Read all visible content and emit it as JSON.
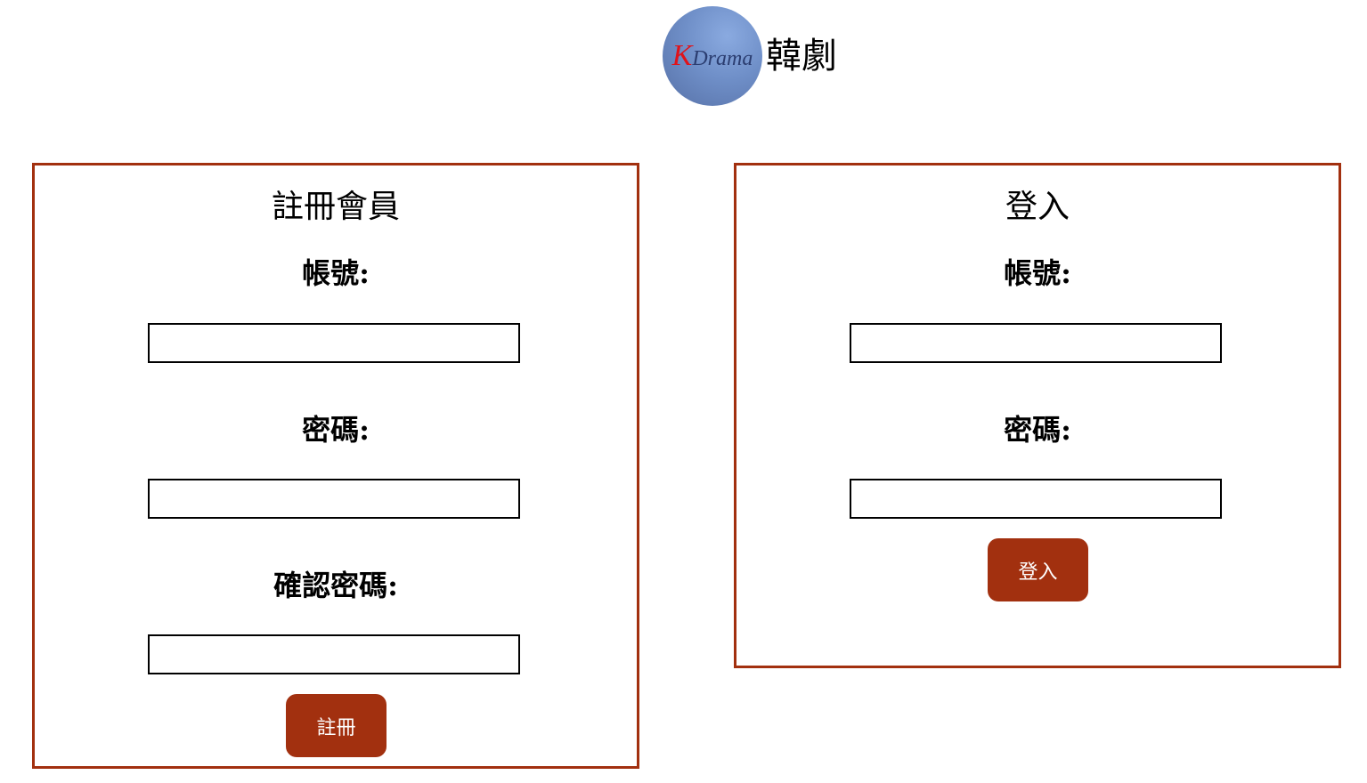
{
  "header": {
    "logo_k": "K",
    "logo_drama": "Drama",
    "site_title": "韓劇"
  },
  "register": {
    "title": "註冊會員",
    "account_label": "帳號:",
    "account_value": "",
    "password_label": "密碼:",
    "password_value": "",
    "confirm_label": "確認密碼:",
    "confirm_value": "",
    "submit_label": "註冊"
  },
  "login": {
    "title": "登入",
    "account_label": "帳號:",
    "account_value": "",
    "password_label": "密碼:",
    "password_value": "",
    "submit_label": "登入"
  },
  "colors": {
    "accent": "#a2300f",
    "logo_blue": "#6f8fc8",
    "logo_red": "#e0131a"
  }
}
